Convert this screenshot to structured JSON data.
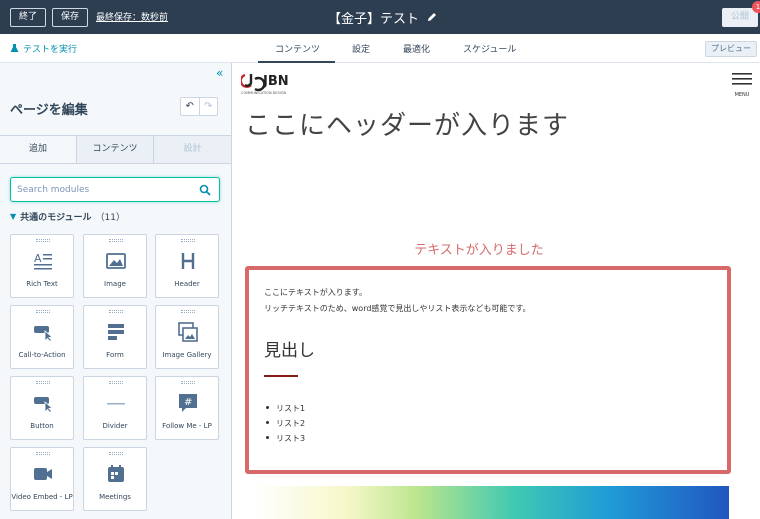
{
  "topbar": {
    "exit_label": "終了",
    "save_label": "保存",
    "last_saved": "最終保存：数秒前",
    "page_title": "【金子】テスト",
    "publish_label": "公開",
    "notification_count": "1"
  },
  "tabbar": {
    "run_test_label": "テストを実行",
    "tabs": [
      "コンテンツ",
      "設定",
      "最適化",
      "スケジュール"
    ],
    "active_tab": "コンテンツ",
    "preview_label": "プレビュー"
  },
  "sidebar": {
    "title": "ページを編集",
    "tabs": [
      "追加",
      "コンテンツ",
      "設計"
    ],
    "search": {
      "placeholder": "Search modules",
      "value": ""
    },
    "group": {
      "label": "共通のモジュール",
      "count": "（11）"
    },
    "modules": [
      {
        "label": "Rich Text",
        "icon": "rich-text-icon"
      },
      {
        "label": "Image",
        "icon": "image-icon"
      },
      {
        "label": "Header",
        "icon": "header-icon"
      },
      {
        "label": "Call-to-Action",
        "icon": "cta-icon"
      },
      {
        "label": "Form",
        "icon": "form-icon"
      },
      {
        "label": "Image Gallery",
        "icon": "image-gallery-icon"
      },
      {
        "label": "Button",
        "icon": "button-icon"
      },
      {
        "label": "Divider",
        "icon": "divider-icon"
      },
      {
        "label": "Follow Me - LP",
        "icon": "follow-me-icon"
      },
      {
        "label": "Video Embed - LP",
        "icon": "video-icon"
      },
      {
        "label": "Meetings",
        "icon": "meetings-icon"
      }
    ]
  },
  "content": {
    "logo_text": "JBN",
    "logo_tagline": "COMMUNICATION DESIGN",
    "menu_label": "MENU",
    "header_text": "ここにヘッダーが入ります",
    "sub_heading": "テキストが入りました",
    "paragraph_lines": [
      "ここにテキストが入ります。",
      "リッチテキストのため、word感覚で見出しやリスト表示なども可能です。"
    ],
    "heading": "見出し",
    "list_items": [
      "リスト1",
      "リスト2",
      "リスト3"
    ]
  },
  "colors": {
    "topbar_bg": "#2d3e50",
    "accent_teal": "#0091ae",
    "richtext_border": "#d66a6a",
    "subhead_red": "#d66b6b"
  }
}
